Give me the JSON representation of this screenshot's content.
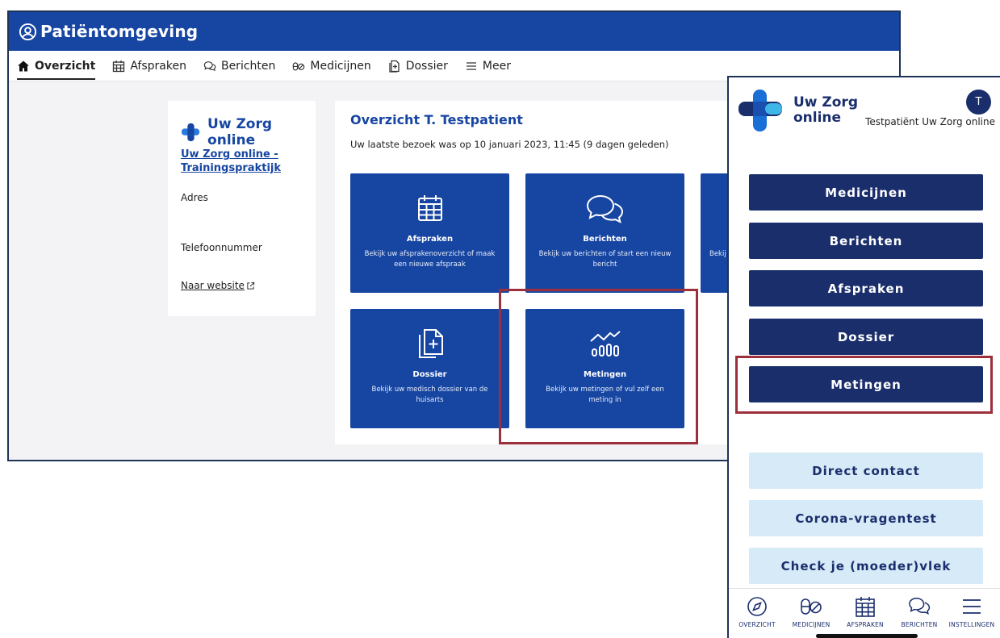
{
  "desktop": {
    "header_title": "Patiëntomgeving",
    "nav": [
      {
        "label": "Overzicht",
        "icon": "home-icon",
        "active": true
      },
      {
        "label": "Afspraken",
        "icon": "calendar-icon"
      },
      {
        "label": "Berichten",
        "icon": "chat-icon"
      },
      {
        "label": "Medicijnen",
        "icon": "pills-icon"
      },
      {
        "label": "Dossier",
        "icon": "document-icon"
      },
      {
        "label": "Meer",
        "icon": "menu-icon"
      }
    ],
    "info_card": {
      "brand": "Uw Zorg online",
      "practice_link": "Uw Zorg online - Trainingspraktijk",
      "address_label": "Adres",
      "phone_label": "Telefoonnummer",
      "website_link": "Naar website"
    },
    "overview": {
      "title": "Overzicht T. Testpatient",
      "last_visit": "Uw laatste bezoek was op 10 januari 2023, 11:45 (9 dagen geleden)",
      "tiles": [
        {
          "title": "Afspraken",
          "desc": "Bekijk uw afsprakenoverzicht of maak een nieuwe afspraak",
          "icon": "calendar-icon"
        },
        {
          "title": "Berichten",
          "desc": "Bekijk uw berichten of start een nieuw bericht",
          "icon": "chat-icon"
        },
        {
          "desc_partial": "Bekij"
        },
        {
          "title": "Dossier",
          "desc": "Bekijk uw medisch dossier van de huisarts",
          "icon": "dossier-icon"
        },
        {
          "title": "Metingen",
          "desc": "Bekijk uw metingen of vul zelf een meting in",
          "icon": "measurements-icon"
        }
      ]
    }
  },
  "mobile": {
    "brand_line1": "Uw Zorg",
    "brand_line2": "online",
    "avatar_initial": "T",
    "user_name": "Testpatiënt Uw Zorg online",
    "primary_buttons": [
      "Medicijnen",
      "Berichten",
      "Afspraken",
      "Dossier",
      "Metingen"
    ],
    "secondary_buttons": [
      "Direct contact",
      "Corona-vragentest",
      "Check je (moeder)vlek"
    ],
    "tabbar": [
      {
        "label": "OVERZICHT",
        "icon": "compass-icon"
      },
      {
        "label": "MEDICIJNEN",
        "icon": "pills-icon"
      },
      {
        "label": "AFSPRAKEN",
        "icon": "calendar-icon"
      },
      {
        "label": "BERICHTEN",
        "icon": "chat-icon"
      },
      {
        "label": "INSTELLINGEN",
        "icon": "menu-icon"
      }
    ]
  },
  "colors": {
    "desktop_blue": "#1746a2",
    "mobile_navy": "#1a2e6c",
    "mobile_light": "#d6eaf8",
    "highlight": "#9c2f3c"
  }
}
